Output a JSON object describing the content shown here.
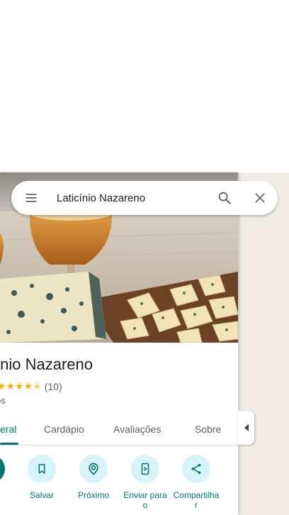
{
  "search": {
    "value": "Laticínio Nazareno",
    "menu_icon": "menu-icon",
    "search_icon": "search-icon",
    "close_icon": "close-icon"
  },
  "place": {
    "name": "Laticínio Nazareno",
    "name_visible": "ínio Nazareno",
    "rating_stars_visible": "★★★★",
    "rating_value": 4.5,
    "reviews_count": "(10)",
    "category_visible": "os"
  },
  "tabs": [
    {
      "label": "eral",
      "active": true
    },
    {
      "label": "Cardápio",
      "active": false
    },
    {
      "label": "Avaliações",
      "active": false
    },
    {
      "label": "Sobre",
      "active": false
    }
  ],
  "actions": [
    {
      "label": "s",
      "icon": "directions-icon"
    },
    {
      "label": "Salvar",
      "icon": "bookmark-icon"
    },
    {
      "label": "Próximo",
      "icon": "nearby-icon"
    },
    {
      "label": "Enviar para\no",
      "icon": "send-to-phone-icon"
    },
    {
      "label": "Compartilha\nr",
      "icon": "share-icon"
    }
  ],
  "colors": {
    "accent": "#00796b",
    "action_bg": "#d8f4fb",
    "star": "#f4b400",
    "map_bg": "#f1ede6"
  },
  "collapse_icon": "chevron-left-icon"
}
